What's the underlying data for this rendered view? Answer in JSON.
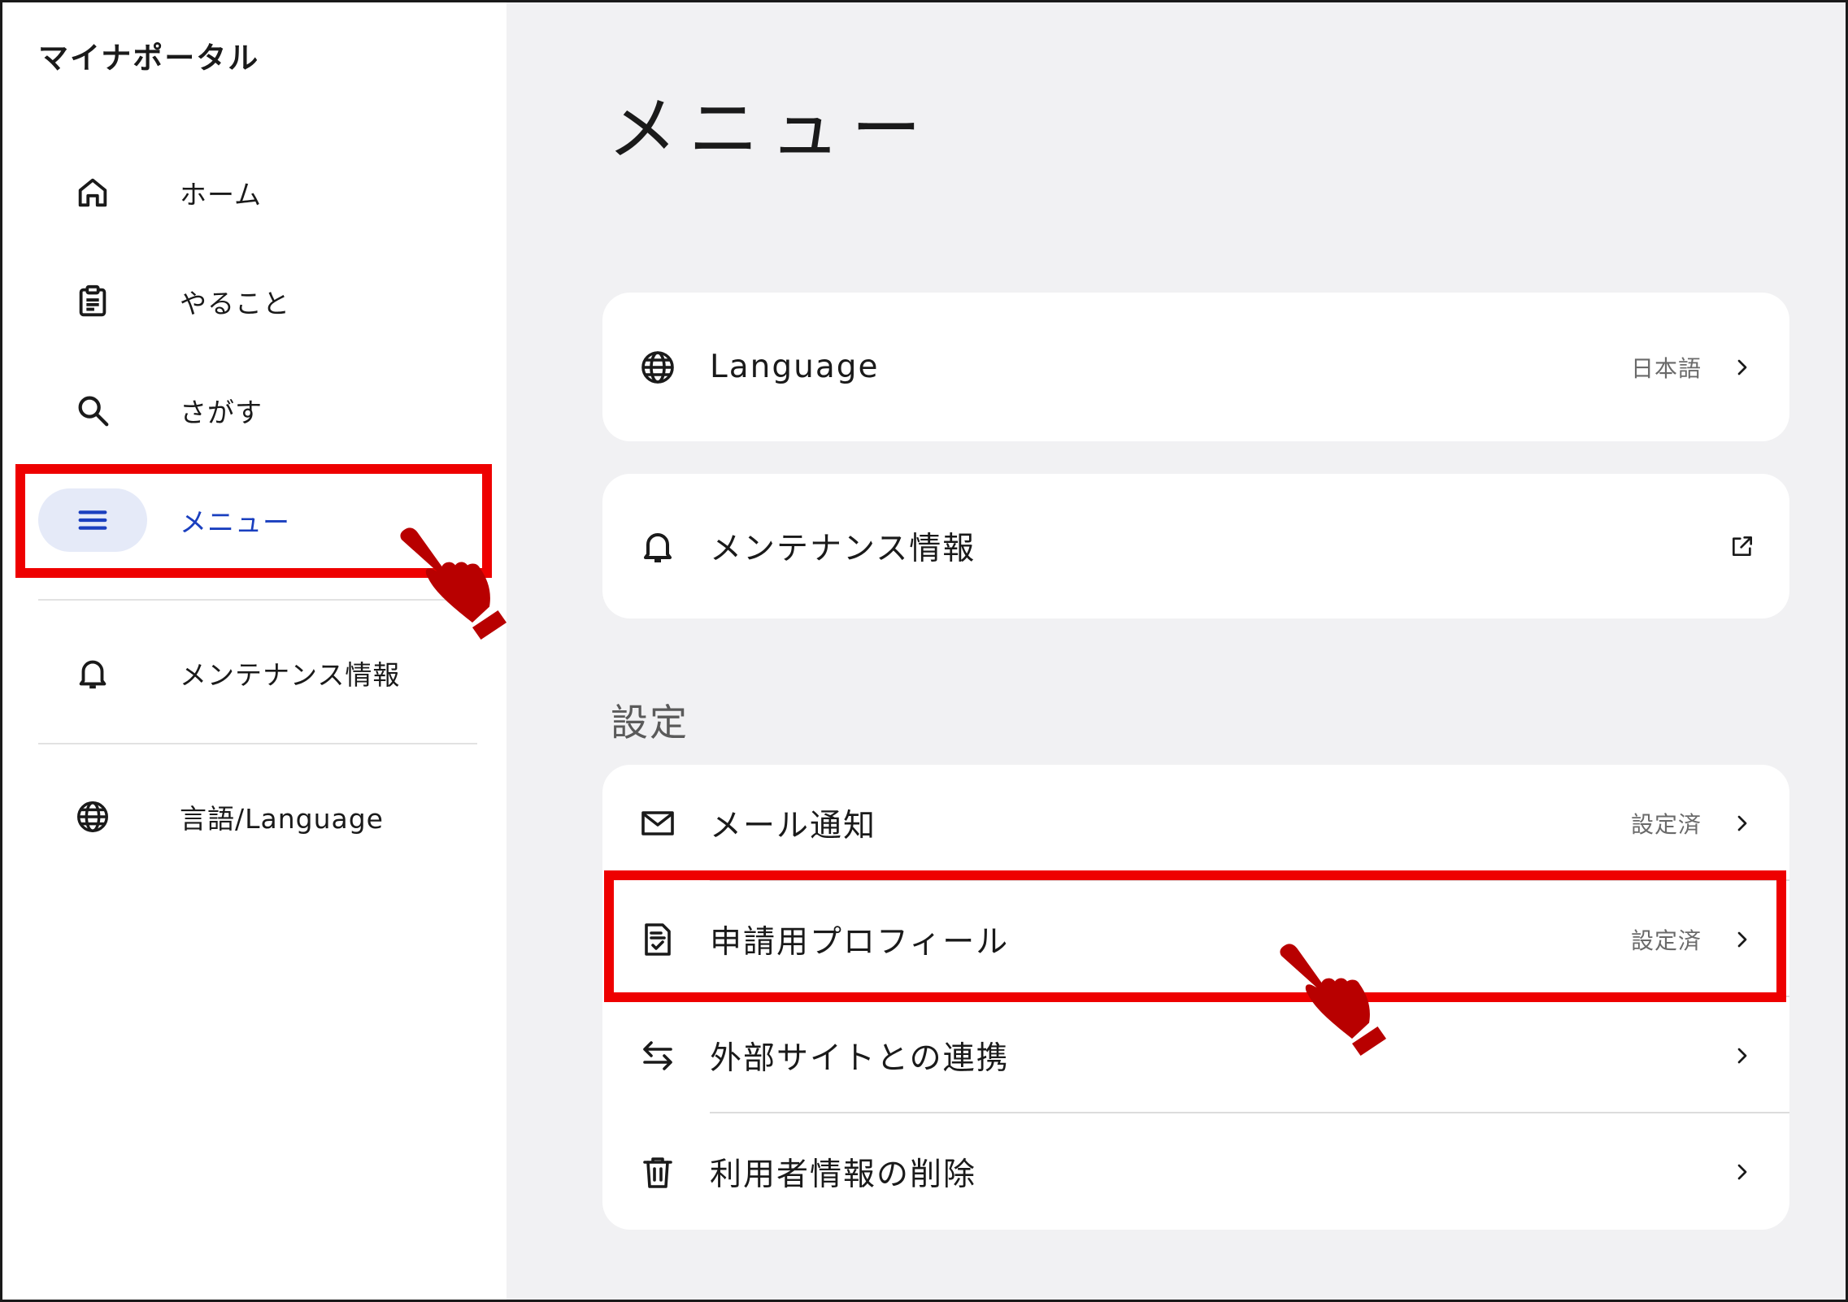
{
  "app_title": "マイナポータル",
  "sidebar": {
    "items": [
      {
        "label": "ホーム",
        "icon": "home-icon"
      },
      {
        "label": "やること",
        "icon": "clipboard-icon"
      },
      {
        "label": "さがす",
        "icon": "search-icon"
      },
      {
        "label": "メニュー",
        "icon": "menu-icon",
        "active": true
      },
      {
        "label": "メンテナンス情報",
        "icon": "bell-icon"
      },
      {
        "label": "言語/Language",
        "icon": "globe-icon"
      }
    ]
  },
  "main": {
    "title": "メニュー",
    "language_card": {
      "label": "Language",
      "value": "日本語",
      "icon": "globe-icon"
    },
    "maintenance_card": {
      "label": "メンテナンス情報",
      "icon": "bell-icon",
      "trail_icon": "external-link-icon"
    },
    "settings": {
      "title": "設定",
      "rows": [
        {
          "label": "メール通知",
          "value": "設定済",
          "icon": "mail-icon"
        },
        {
          "label": "申請用プロフィール",
          "value": "設定済",
          "icon": "document-check-icon"
        },
        {
          "label": "外部サイトとの連携",
          "value": "",
          "icon": "arrows-swap-icon"
        },
        {
          "label": "利用者情報の削除",
          "value": "",
          "icon": "trash-icon"
        }
      ]
    }
  },
  "colors": {
    "accent": "#1a3fbf",
    "highlight": "#ee0000",
    "hand": "#b80000",
    "main_bg": "#f1f1f3"
  }
}
